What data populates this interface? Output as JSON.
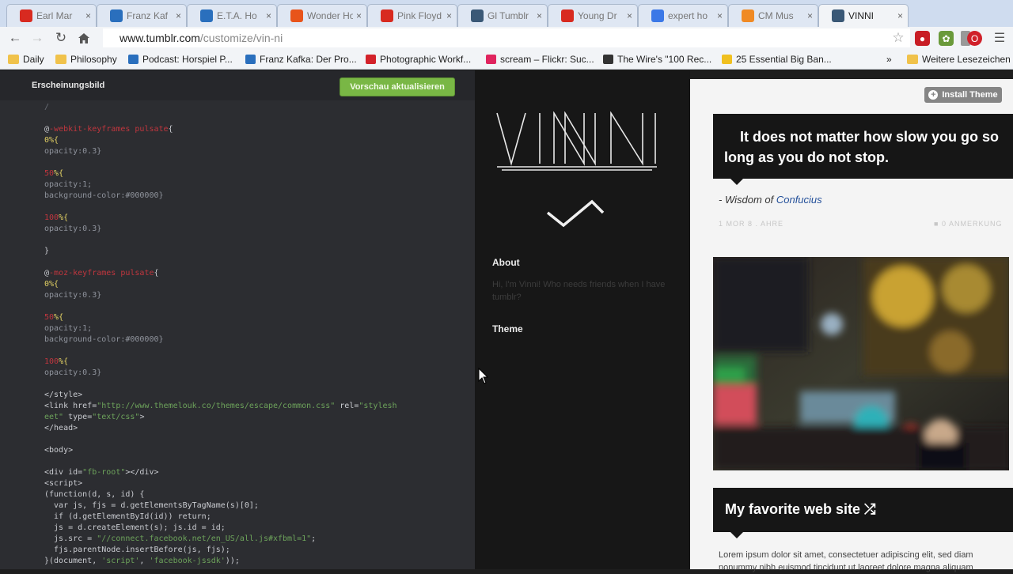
{
  "browser": {
    "tabs": [
      {
        "label": "Earl Mar",
        "icon": "youtube-icon",
        "color": "#d82a20"
      },
      {
        "label": "Franz Kaf",
        "icon": "bookmark-br-icon",
        "color": "#2a6fbd"
      },
      {
        "label": "E.T.A. Ho",
        "icon": "bookmark-br-icon",
        "color": "#2a6fbd"
      },
      {
        "label": "Wonder Ho",
        "icon": "soundcloud-icon",
        "color": "#e8541b"
      },
      {
        "label": "Pink Floyd",
        "icon": "youtube-icon",
        "color": "#d82a20"
      },
      {
        "label": "Gl Tumblr",
        "icon": "tumblr-icon",
        "color": "#3a5876"
      },
      {
        "label": "Young Dr",
        "icon": "youtube-icon",
        "color": "#d82a20"
      },
      {
        "label": "expert ho",
        "icon": "search-icon",
        "color": "#3b78e7"
      },
      {
        "label": "CM Mus",
        "icon": "music-icon",
        "color": "#f08a24"
      },
      {
        "label": "VINNI",
        "icon": "tumblr-icon",
        "color": "#3a5876"
      }
    ],
    "url_host": "www.tumblr.com",
    "url_path": "/customize/vin-ni",
    "bookmarks": [
      {
        "label": "Daily",
        "icon": "folder-icon"
      },
      {
        "label": "Philosophy",
        "icon": "folder-icon"
      },
      {
        "label": "Podcast: Horspiel P...",
        "icon": "bookmark-br-icon"
      },
      {
        "label": "Franz Kafka: Der Pro...",
        "icon": "bookmark-br-icon"
      },
      {
        "label": "Photographic Workf...",
        "icon": "adobe-icon"
      },
      {
        "label": "scream – Flickr: Suc...",
        "icon": "flickr-icon"
      },
      {
        "label": "The Wire's \"100 Rec...",
        "icon": "wikipedia-icon"
      },
      {
        "label": "25 Essential Big Ban...",
        "icon": "star-icon"
      }
    ],
    "bookmarks_overflow": "»",
    "other_bookmarks": "Weitere Lesezeichen"
  },
  "editor": {
    "title": "Erscheinungsbild",
    "preview_button": "Vorschau aktualisieren",
    "code_lines": [
      [
        {
          "t": "/",
          "c": "c-dim"
        }
      ],
      [],
      [
        {
          "t": "@",
          "c": ""
        },
        {
          "t": "-webkit-keyframes pulsate",
          "c": "c-red"
        },
        {
          "t": "{",
          "c": ""
        }
      ],
      [
        {
          "t": "0%{",
          "c": "c-yel"
        }
      ],
      [
        {
          "t": "opacity:0.3}",
          "c": "c-gry"
        }
      ],
      [],
      [
        {
          "t": "50",
          "c": "c-red"
        },
        {
          "t": "%{",
          "c": "c-yel"
        }
      ],
      [
        {
          "t": "opacity:1;",
          "c": "c-gry"
        }
      ],
      [
        {
          "t": "background-color:#000000}",
          "c": "c-gry"
        }
      ],
      [],
      [
        {
          "t": "100",
          "c": "c-red"
        },
        {
          "t": "%{",
          "c": "c-yel"
        }
      ],
      [
        {
          "t": "opacity:0.3}",
          "c": "c-gry"
        }
      ],
      [],
      [
        {
          "t": "}",
          "c": ""
        }
      ],
      [],
      [
        {
          "t": "@",
          "c": ""
        },
        {
          "t": "-moz-keyframes pulsate",
          "c": "c-red"
        },
        {
          "t": "{",
          "c": ""
        }
      ],
      [
        {
          "t": "0%{",
          "c": "c-yel"
        }
      ],
      [
        {
          "t": "opacity:0.3}",
          "c": "c-gry"
        }
      ],
      [],
      [
        {
          "t": "50",
          "c": "c-red"
        },
        {
          "t": "%{",
          "c": "c-yel"
        }
      ],
      [
        {
          "t": "opacity:1;",
          "c": "c-gry"
        }
      ],
      [
        {
          "t": "background-color:#000000}",
          "c": "c-gry"
        }
      ],
      [],
      [
        {
          "t": "100",
          "c": "c-red"
        },
        {
          "t": "%{",
          "c": "c-yel"
        }
      ],
      [
        {
          "t": "opacity:0.3}",
          "c": "c-gry"
        }
      ],
      [],
      [
        {
          "t": "</style>",
          "c": ""
        }
      ],
      [
        {
          "t": "<link href=",
          "c": ""
        },
        {
          "t": "\"http://www.themelouk.co/themes/escape/common.css\"",
          "c": "c-grn"
        },
        {
          "t": " rel=",
          "c": ""
        },
        {
          "t": "\"stylesh",
          "c": "c-grn"
        }
      ],
      [
        {
          "t": "eet\"",
          "c": "c-grn"
        },
        {
          "t": " type=",
          "c": ""
        },
        {
          "t": "\"text/css\"",
          "c": "c-grn"
        },
        {
          "t": ">",
          "c": ""
        }
      ],
      [
        {
          "t": "</head>",
          "c": ""
        }
      ],
      [],
      [
        {
          "t": "<body>",
          "c": ""
        }
      ],
      [],
      [
        {
          "t": "<div id=",
          "c": ""
        },
        {
          "t": "\"fb-root\"",
          "c": "c-grn"
        },
        {
          "t": "></div>",
          "c": ""
        }
      ],
      [
        {
          "t": "<script>",
          "c": ""
        }
      ],
      [
        {
          "t": "(function(d, s, id) {",
          "c": ""
        }
      ],
      [
        {
          "t": "  var js, fjs = d.getElementsByTagName(s)[0];",
          "c": ""
        }
      ],
      [
        {
          "t": "  if (d.getElementById(id)) return;",
          "c": ""
        }
      ],
      [
        {
          "t": "  js = d.createElement(s); js.id = id;",
          "c": ""
        }
      ],
      [
        {
          "t": "  js.src = ",
          "c": ""
        },
        {
          "t": "\"//connect.facebook.net/en_US/all.js#xfbml=1\"",
          "c": "c-grn"
        },
        {
          "t": ";",
          "c": ""
        }
      ],
      [
        {
          "t": "  fjs.parentNode.insertBefore(js, fjs);",
          "c": ""
        }
      ],
      [
        {
          "t": "}(document, ",
          "c": ""
        },
        {
          "t": "'script'",
          "c": "c-grn"
        },
        {
          "t": ", ",
          "c": ""
        },
        {
          "t": "'facebook-jssdk'",
          "c": "c-grn"
        },
        {
          "t": "));",
          "c": ""
        }
      ]
    ]
  },
  "sidebar": {
    "logo_text": "VINNI",
    "about_heading": "About",
    "about_text": "Hi, I'm Vinni! Who needs friends when I have tumblr?",
    "theme_heading": "Theme"
  },
  "content": {
    "install_button": "Install Theme",
    "quote": "It does not matter how slow you go so long as you do not stop.",
    "quote_source_prefix": "- Wisdom of ",
    "quote_source_link": "Confucius",
    "meta_left": "1 MOR 8 . AHRE",
    "meta_right": "0 ANMERKUNG",
    "link_title": "My favorite web site ⤮",
    "lorem": "Lorem ipsum dolor sit amet, consectetuer adipiscing elit, sed diam nonummy nibh euismod tincidunt ut laoreet dolore magna aliquam"
  }
}
